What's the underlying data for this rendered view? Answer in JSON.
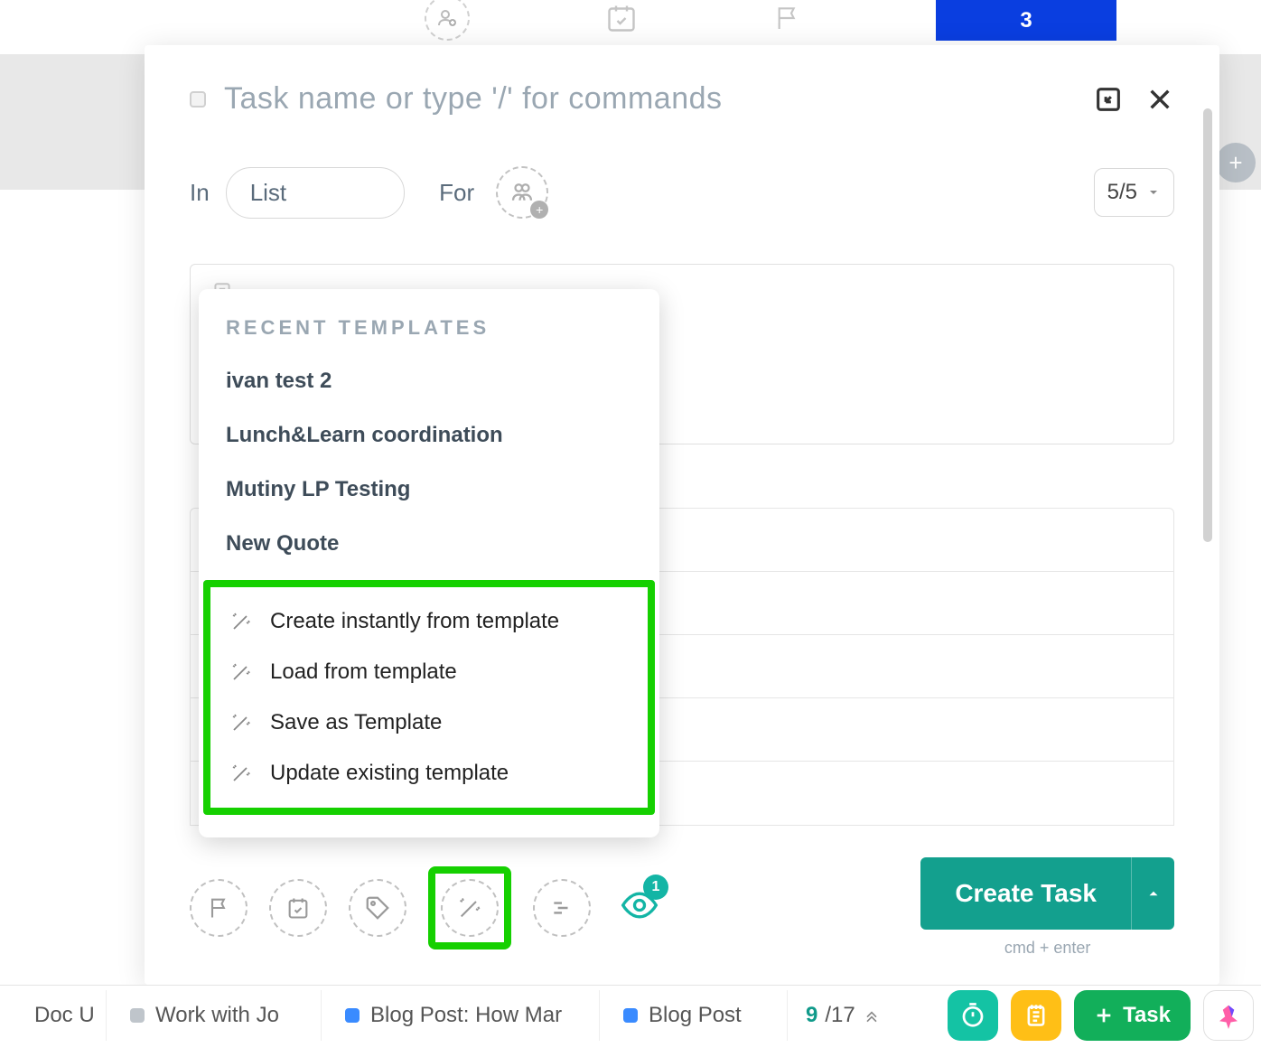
{
  "top": {
    "count_badge": "3"
  },
  "modal": {
    "task_name_placeholder": "Task name or type '/' for commands",
    "in_label": "In",
    "list_value": "List",
    "for_label": "For",
    "counter": "5/5"
  },
  "dropdown": {
    "header": "RECENT TEMPLATES",
    "recent": [
      "ivan test 2",
      "Lunch&Learn coordination",
      "Mutiny LP Testing",
      "New Quote"
    ],
    "actions": [
      "Create instantly from template",
      "Load from template",
      "Save as Template",
      "Update existing template"
    ]
  },
  "watch_count": "1",
  "create": {
    "label": "Create Task",
    "hint": "cmd + enter"
  },
  "taskbar": {
    "items": [
      {
        "color": "blue",
        "label": "Doc U"
      },
      {
        "color": "gray",
        "label": "Work with Jo"
      },
      {
        "color": "blue",
        "label": "Blog Post: How Mar"
      },
      {
        "color": "blue",
        "label": "Blog Post"
      }
    ],
    "count_current": "9",
    "count_total": "/17",
    "task_button": "Task"
  }
}
